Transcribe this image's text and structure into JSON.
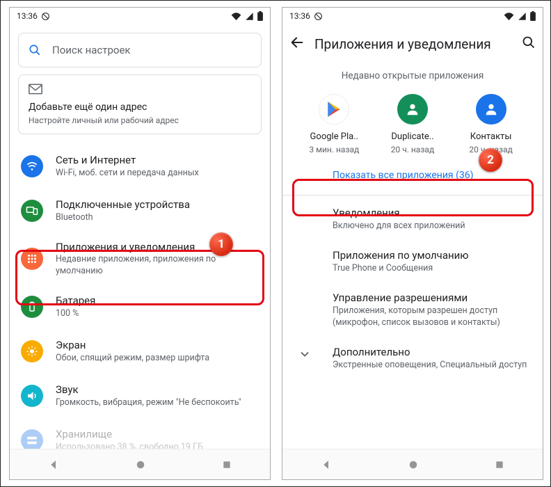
{
  "status": {
    "time": "13:36"
  },
  "left": {
    "search_placeholder": "Поиск настроек",
    "card": {
      "title": "Добавьте ещё один адрес",
      "sub": "Настройте личный или рабочий адрес"
    },
    "items": [
      {
        "title": "Сеть и Интернет",
        "sub": "Wi-Fi, моб. сети и передача данных",
        "color": "#1a73e8",
        "icon": "wifi"
      },
      {
        "title": "Подключенные устройства",
        "sub": "Bluetooth",
        "color": "#1e8e3e",
        "icon": "devices"
      },
      {
        "title": "Приложения и уведомления",
        "sub": "Недавние приложения, приложения по умолчанию",
        "color": "#f9683a",
        "icon": "apps"
      },
      {
        "title": "Батарея",
        "sub": "100 %",
        "color": "#1e8e3e",
        "icon": "battery"
      },
      {
        "title": "Экран",
        "sub": "Обои, спящий режим, размер шрифта",
        "color": "#f9ab00",
        "icon": "display"
      },
      {
        "title": "Звук",
        "sub": "Громкость, вибрация, режим \"Не беспокоить\"",
        "color": "#12b5cb",
        "icon": "sound"
      },
      {
        "title": "Хранилище",
        "sub": "Использовано 38 %, свободно 19 ГБ",
        "color": "#5f6368",
        "icon": "storage"
      }
    ]
  },
  "right": {
    "title": "Приложения и уведомления",
    "recent_title": "Недавно открытые приложения",
    "apps": [
      {
        "name": "Google Pla..",
        "time": "3 мин. назад",
        "icon": "play"
      },
      {
        "name": "Duplicate..",
        "time": "20 ч. назад",
        "icon": "dup"
      },
      {
        "name": "Контакты",
        "time": "20 ч. назад",
        "icon": "contacts"
      }
    ],
    "show_all": "Показать все приложения (36)",
    "items": [
      {
        "title": "Уведомления",
        "sub": "Включено для всех приложений"
      },
      {
        "title": "Приложения по умолчанию",
        "sub": "True Phone и Сообщения"
      },
      {
        "title": "Управление разрешениями",
        "sub": "Приложения, которым разрешен доступ (микрофон, список вызовов и контакты)"
      },
      {
        "title": "Дополнительно",
        "sub": "Экстренные оповещения, Специальный доступ",
        "expand": true
      }
    ]
  },
  "markers": {
    "one": "1",
    "two": "2"
  }
}
